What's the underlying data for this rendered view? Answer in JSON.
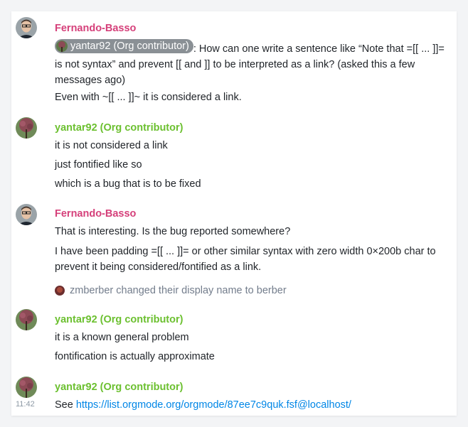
{
  "messages_groups": [
    {
      "sender": "Fernando-Basso",
      "mention": "yantar92 (Org contributor)",
      "lines": [
        ": How can one write a sentence like “Note that =[[ ... ]]= is not syntax” and prevent [[ and ]] to be interpreted as a link? (asked this a few messages ago)",
        "Even with ~[[ ... ]]~ it is considered a link."
      ]
    },
    {
      "sender": "yantar92 (Org contributor)",
      "lines": [
        "it is not considered a link",
        "just fontified like so",
        "which is a bug that is to be fixed"
      ]
    },
    {
      "sender": "Fernando-Basso",
      "lines": [
        "That is interesting. Is the bug reported somewhere?",
        "I have been padding =[[ ... ]]= or other similar syntax with zero width 0×200b char to prevent it being considered/fontified as a link."
      ],
      "notice": "zmberber changed their display name to berber"
    },
    {
      "sender": "yantar92 (Org contributor)",
      "lines": [
        "it is a known general problem",
        "fontification is actually approximate"
      ]
    },
    {
      "sender": "yantar92 (Org contributor)",
      "timestamp": "11:42",
      "see_label": "See",
      "link": "https://list.orgmode.org/orgmode/87ee7c9quk.fsf@localhost/"
    }
  ],
  "colors": {
    "fernando_name": "#d5407a",
    "yantar_name": "#6cc030",
    "link": "#0086e6",
    "mention_pill": "#8a9095"
  }
}
